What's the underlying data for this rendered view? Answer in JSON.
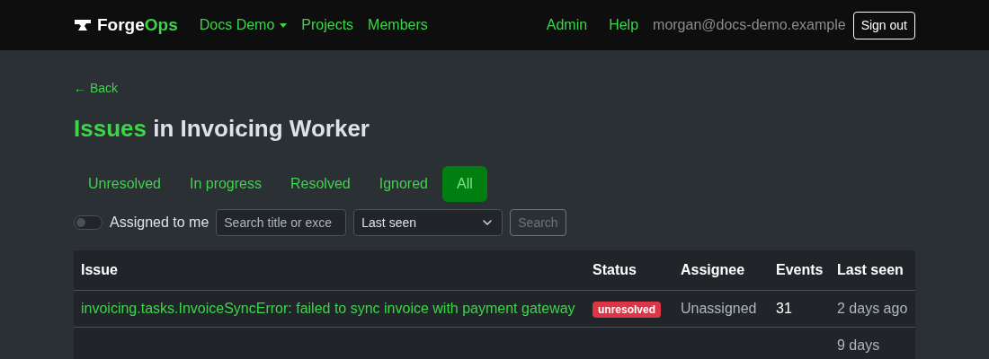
{
  "navbar": {
    "brand": {
      "first": "Forge",
      "second": "Ops"
    },
    "links": [
      {
        "label": "Docs Demo",
        "dropdown": true
      },
      {
        "label": "Projects",
        "dropdown": false
      },
      {
        "label": "Members",
        "dropdown": false
      }
    ],
    "right_links": [
      "Admin",
      "Help"
    ],
    "user": "morgan@docs-demo.example",
    "sign_out": "Sign out"
  },
  "back": "← Back",
  "heading": {
    "highlight": "Issues",
    "rest": "in Invoicing Worker"
  },
  "tabs": [
    {
      "label": "Unresolved",
      "selected": false
    },
    {
      "label": "In progress",
      "selected": false
    },
    {
      "label": "Resolved",
      "selected": false
    },
    {
      "label": "Ignored",
      "selected": false
    },
    {
      "label": "All",
      "selected": true
    }
  ],
  "filters": {
    "assigned_toggle": {
      "label": "Assigned to me",
      "on": false
    },
    "search": {
      "placeholder": "Search title or exce"
    },
    "sort": {
      "value": "Last seen"
    },
    "search_button": {
      "label": "Search",
      "disabled": true
    }
  },
  "table": {
    "columns": [
      "Issue",
      "Status",
      "Assignee",
      "Events",
      "Last seen"
    ],
    "rows": [
      {
        "issue": "invoicing.tasks.InvoiceSyncError: failed to sync invoice with payment gateway",
        "status": "unresolved",
        "assignee": "Unassigned",
        "events": "31",
        "last_seen": "2 days ago"
      },
      {
        "issue": "",
        "status": "",
        "assignee": "",
        "events": "",
        "last_seen": "9 days"
      }
    ]
  }
}
